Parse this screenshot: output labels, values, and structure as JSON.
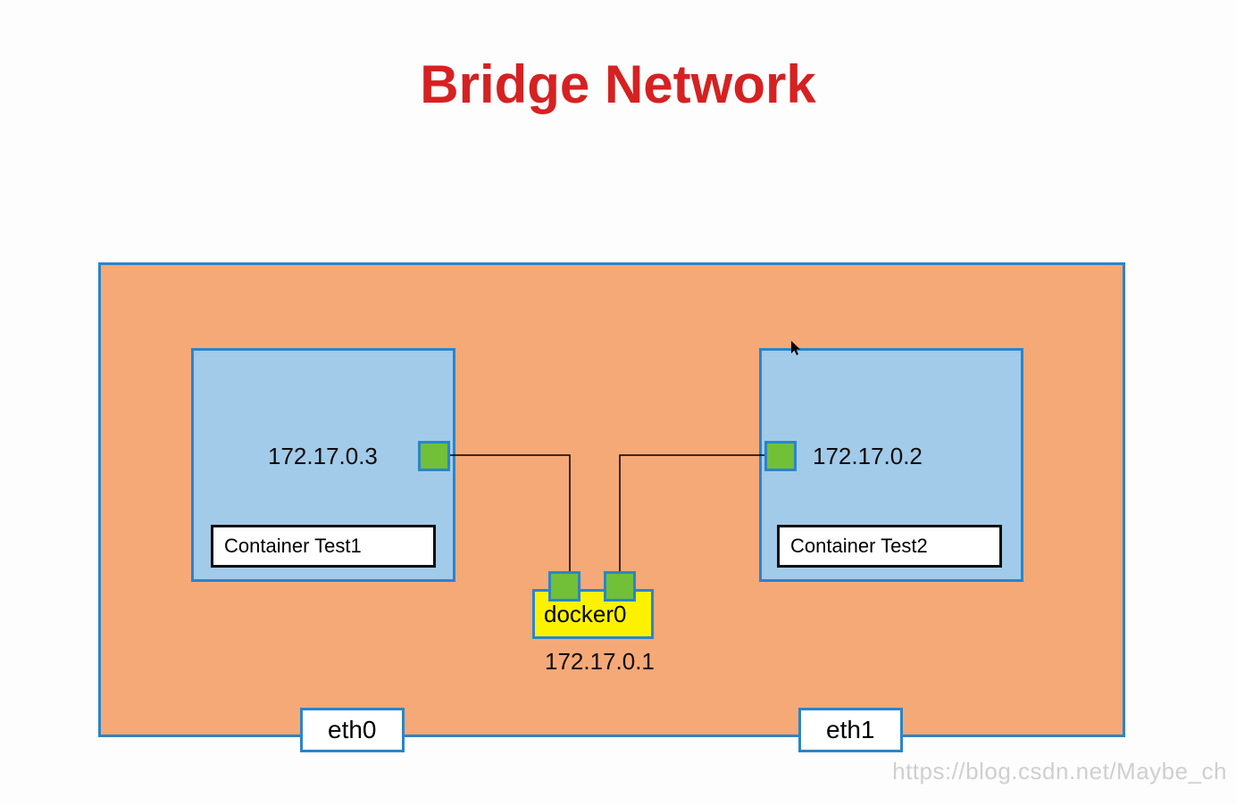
{
  "title": "Bridge Network",
  "host": {
    "interfaces": [
      "eth0",
      "eth1"
    ]
  },
  "containers": [
    {
      "name": "Container Test1",
      "ip": "172.17.0.3"
    },
    {
      "name": "Container Test2",
      "ip": "172.17.0.2"
    }
  ],
  "bridge": {
    "name": "docker0",
    "ip": "172.17.0.1"
  },
  "watermark": "https://blog.csdn.net/Maybe_ch",
  "colors": {
    "title": "#d62122",
    "host_fill": "#f5a977",
    "border_blue": "#2a85c9",
    "container_fill": "#a2cae9",
    "port_green": "#71c037",
    "docker0_fill": "#fcf200"
  }
}
